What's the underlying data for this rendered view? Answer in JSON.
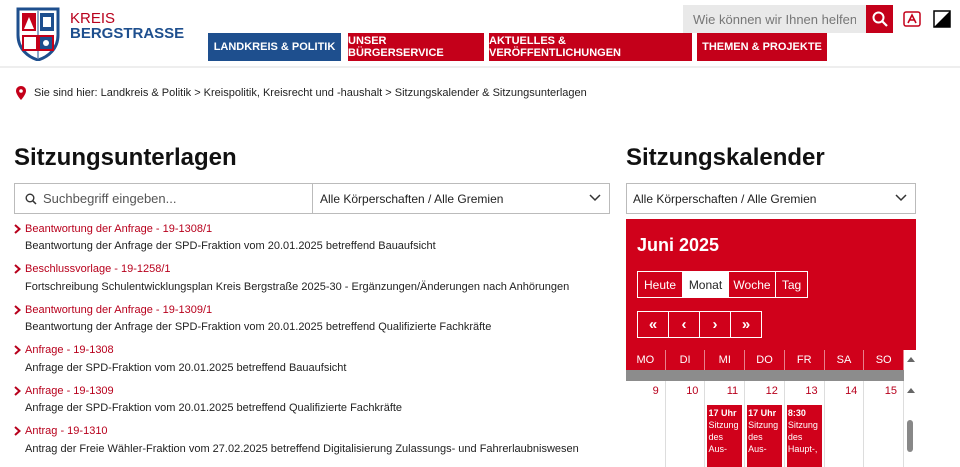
{
  "brand": {
    "line1": "KREIS",
    "line2": "BERGSTRASSE"
  },
  "search": {
    "placeholder": "Wie können wir Ihnen helfen?"
  },
  "nav": [
    {
      "label": "LANDKREIS & POLITIK"
    },
    {
      "label": "UNSER BÜRGERSERVICE"
    },
    {
      "label": "AKTUELLES & VERÖFFENTLICHUNGEN"
    },
    {
      "label": "THEMEN & PROJEKTE"
    }
  ],
  "breadcrumb": {
    "text": "Sie sind hier: Landkreis & Politik > Kreispolitik, Kreisrecht und -haushalt > Sitzungskalender & Sitzungsunterlagen"
  },
  "left": {
    "heading": "Sitzungsunterlagen",
    "search_placeholder": "Suchbegriff eingeben...",
    "filter": "Alle Körperschaften / Alle Gremien",
    "items": [
      {
        "title": "Beantwortung der Anfrage - 19-1308/1",
        "desc": "Beantwortung der Anfrage der SPD-Fraktion vom 20.01.2025 betreffend Bauaufsicht"
      },
      {
        "title": "Beschlussvorlage - 19-1258/1",
        "desc": "Fortschreibung Schulentwicklungsplan Kreis Bergstraße 2025-30 - Ergänzungen/Änderungen nach Anhörungen"
      },
      {
        "title": "Beantwortung der Anfrage - 19-1309/1",
        "desc": "Beantwortung der Anfrage der SPD-Fraktion vom 20.01.2025 betreffend Qualifizierte Fachkräfte"
      },
      {
        "title": "Anfrage - 19-1308",
        "desc": "Anfrage der SPD-Fraktion vom 20.01.2025 betreffend Bauaufsicht"
      },
      {
        "title": "Anfrage - 19-1309",
        "desc": "Anfrage der SPD-Fraktion vom 20.01.2025 betreffend Qualifizierte Fachkräfte"
      },
      {
        "title": "Antrag - 19-1310",
        "desc": "Antrag der Freie Wähler-Fraktion vom 27.02.2025 betreffend Digitalisierung Zulassungs- und Fahrerlaubniswesen"
      }
    ]
  },
  "right": {
    "heading": "Sitzungskalender",
    "filter": "Alle Körperschaften / Alle Gremien",
    "month": "Juni 2025",
    "views": [
      "Heute",
      "Monat",
      "Woche",
      "Tag"
    ],
    "active_view": "Monat",
    "nav": [
      "«",
      "‹",
      "›",
      "»"
    ],
    "weekdays": [
      "MO",
      "DI",
      "MI",
      "DO",
      "FR",
      "SA",
      "SO"
    ],
    "days": [
      "9",
      "10",
      "11",
      "12",
      "13",
      "14",
      "15"
    ],
    "events": [
      {
        "day_index": 2,
        "time": "17 Uhr",
        "text": "Sitzung des Aus-"
      },
      {
        "day_index": 3,
        "time": "17 Uhr",
        "text": "Sitzung des Aus-"
      },
      {
        "day_index": 4,
        "time": "8:30",
        "text": "Sitzung des Haupt-,"
      }
    ]
  },
  "colors": {
    "red": "#c4001a",
    "blue": "#1e4f8e",
    "calendar_red": "#d0011b"
  }
}
